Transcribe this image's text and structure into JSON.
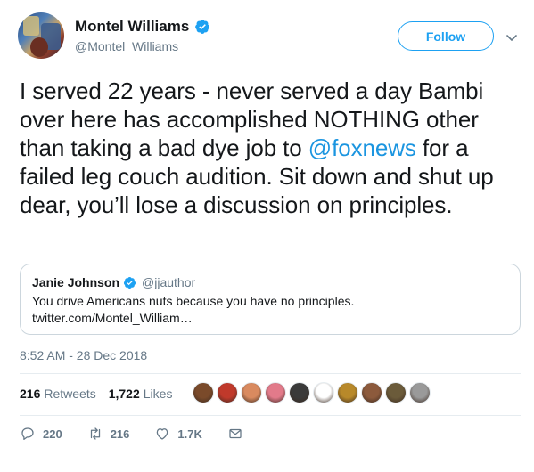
{
  "author": {
    "display_name": "Montel Williams",
    "handle": "@Montel_Williams",
    "verified": true
  },
  "follow_label": "Follow",
  "tweet": {
    "text_before": "I served 22 years - never served a day Bambi over here has accomplished NOTHING other than taking a bad dye job to ",
    "mention": "@foxnews",
    "text_after": " for a failed leg couch audition. Sit down and shut up dear, you’ll lose a discussion on principles."
  },
  "quote": {
    "display_name": "Janie Johnson",
    "handle": "@jjauthor",
    "verified": true,
    "text": "You drive Americans nuts because you have no principles.",
    "link": "twitter.com/Montel_William…"
  },
  "timestamp": "8:52 AM - 28 Dec 2018",
  "stats": {
    "retweets_count": "216",
    "retweets_label": "Retweets",
    "likes_count": "1,722",
    "likes_label": "Likes"
  },
  "likers": [
    {
      "icon": "liker-avatar-1",
      "color": "#7a4a2a"
    },
    {
      "icon": "liker-avatar-2",
      "color": "#c0392b"
    },
    {
      "icon": "liker-avatar-3",
      "color": "#d98a5f"
    },
    {
      "icon": "liker-avatar-4",
      "color": "#e27a8a"
    },
    {
      "icon": "liker-avatar-5",
      "color": "#3a3a3a"
    },
    {
      "icon": "liker-avatar-6",
      "color": "#ffffff"
    },
    {
      "icon": "liker-avatar-7",
      "color": "#b8892a"
    },
    {
      "icon": "liker-avatar-8",
      "color": "#8c5a3c"
    },
    {
      "icon": "liker-avatar-9",
      "color": "#6b5b3a"
    },
    {
      "icon": "liker-avatar-10",
      "color": "#9a9a9a"
    }
  ],
  "actions": {
    "replies": "220",
    "retweets": "216",
    "likes": "1.7K"
  },
  "colors": {
    "accent": "#1da1f2",
    "link": "#1b95e0",
    "secondary_text": "#657786",
    "border": "#ccd6dd"
  }
}
